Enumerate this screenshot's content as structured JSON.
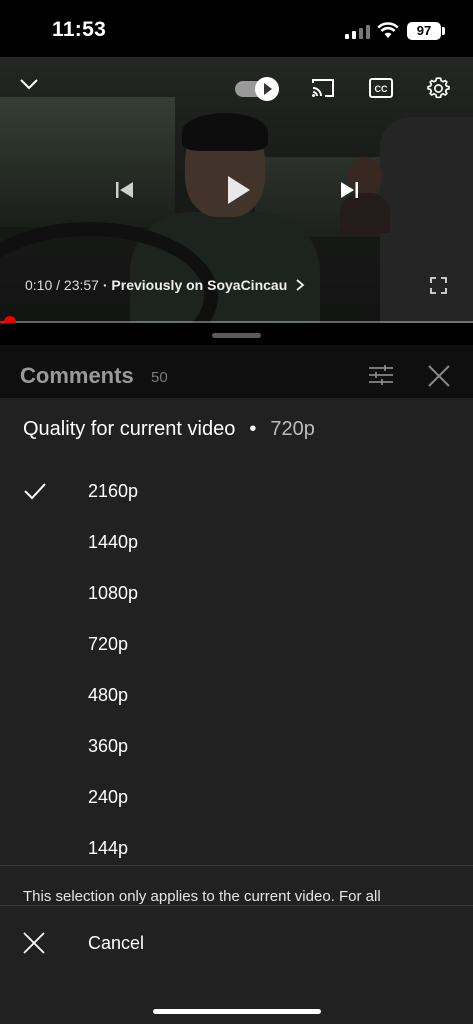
{
  "status_bar": {
    "time": "11:53",
    "battery": "97"
  },
  "player": {
    "current_time": "0:10",
    "duration": "23:57",
    "separator": "/",
    "chapter_link": "· Previously on SoyaCincau",
    "progress_fraction": 0.007,
    "autoplay_on": true
  },
  "comments": {
    "title": "Comments",
    "count": "50"
  },
  "quality_panel": {
    "title": "Quality for current video",
    "dot": "•",
    "current": "720p",
    "options": [
      {
        "label": "2160p",
        "selected": true
      },
      {
        "label": "1440p",
        "selected": false
      },
      {
        "label": "1080p",
        "selected": false
      },
      {
        "label": "720p",
        "selected": false
      },
      {
        "label": "480p",
        "selected": false
      },
      {
        "label": "360p",
        "selected": false
      },
      {
        "label": "240p",
        "selected": false
      },
      {
        "label": "144p",
        "selected": false
      }
    ],
    "note": "This selection only applies to the current video. For all",
    "cancel_label": "Cancel"
  },
  "colors": {
    "accent": "#ff0000",
    "panel_bg": "#212121",
    "header_bg": "#0f0f0f"
  },
  "icons": [
    "chevron-down-icon",
    "autoplay-toggle-icon",
    "cast-icon",
    "captions-icon",
    "settings-gear-icon",
    "previous-icon",
    "play-icon",
    "next-icon",
    "fullscreen-icon",
    "filter-icon",
    "close-icon",
    "check-icon"
  ]
}
